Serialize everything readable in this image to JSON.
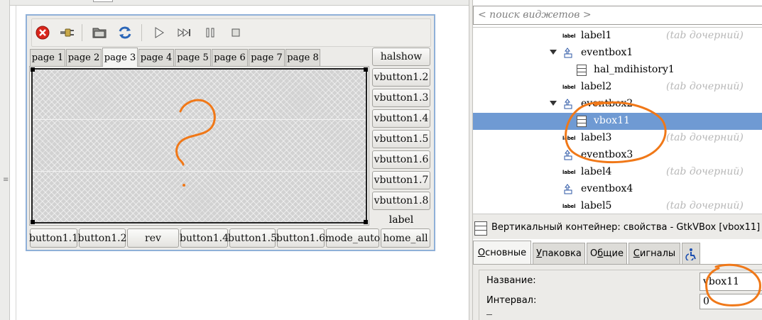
{
  "toolbar": {
    "buttons": [
      {
        "icon": "close-red-icon"
      },
      {
        "icon": "connect-plug-icon"
      },
      {
        "icon": "open-folder-icon"
      },
      {
        "icon": "refresh-icon"
      },
      {
        "icon": "play-icon"
      },
      {
        "icon": "step-forward-icon"
      },
      {
        "icon": "pause-icon"
      },
      {
        "icon": "stop-icon"
      }
    ]
  },
  "tabs": [
    "page 1",
    "page 2",
    "page 3",
    "page 4",
    "page 5",
    "page 6",
    "page 7",
    "page 8"
  ],
  "active_tab": "page 3",
  "side_buttons": [
    "halshow",
    "vbutton1.2",
    "vbutton1.3",
    "vbutton1.4",
    "vbutton1.5",
    "vbutton1.6",
    "vbutton1.7",
    "vbutton1.8"
  ],
  "side_label": "label",
  "bottom_buttons": [
    "button1.1",
    "button1.2",
    "rev",
    "button1.4",
    "button1.5",
    "button1.6",
    "mode_auto",
    "home_all"
  ],
  "search": {
    "placeholder": "< поиск виджетов >"
  },
  "tree": {
    "hint_text": "(tab дочерний)",
    "rows": [
      {
        "name": "label1",
        "hint": "(tab дочерний)"
      },
      {
        "name": "eventbox1",
        "hint": ""
      },
      {
        "name": "hal_mdihistory1",
        "hint": ""
      },
      {
        "name": "label2",
        "hint": "(tab дочерний)"
      },
      {
        "name": "eventbox2",
        "hint": ""
      },
      {
        "name": "vbox11",
        "hint": "",
        "selected": true
      },
      {
        "name": "label3",
        "hint": "(tab дочерний)"
      },
      {
        "name": "eventbox3",
        "hint": ""
      },
      {
        "name": "label4",
        "hint": "(tab дочерний)"
      },
      {
        "name": "eventbox4",
        "hint": ""
      },
      {
        "name": "label5",
        "hint": "(tab дочерний)"
      }
    ],
    "label_icon_text": "label"
  },
  "properties": {
    "title": "Вертикальный контейнер: свойства - GtkVBox [vbox11]",
    "tabs": [
      {
        "label": "Основные",
        "accel": "О",
        "rest": "сновные"
      },
      {
        "label": "Упаковка",
        "accel": "У",
        "rest": "паковка"
      },
      {
        "label": "Общие",
        "accel": "б",
        "pre": "О",
        "rest": "щие"
      },
      {
        "label": "Сигналы",
        "accel": "С",
        "rest": "игналы"
      }
    ],
    "accessibility_icon": "accessibility-icon",
    "fields": {
      "name_label": "Название:",
      "name_value": "vbox11",
      "spacing_label": "Интервал:",
      "spacing_value": "0"
    }
  },
  "colors": {
    "selection": "#6f9ad3",
    "annotation": "#f07818",
    "window_border": "#8fb0d8"
  }
}
